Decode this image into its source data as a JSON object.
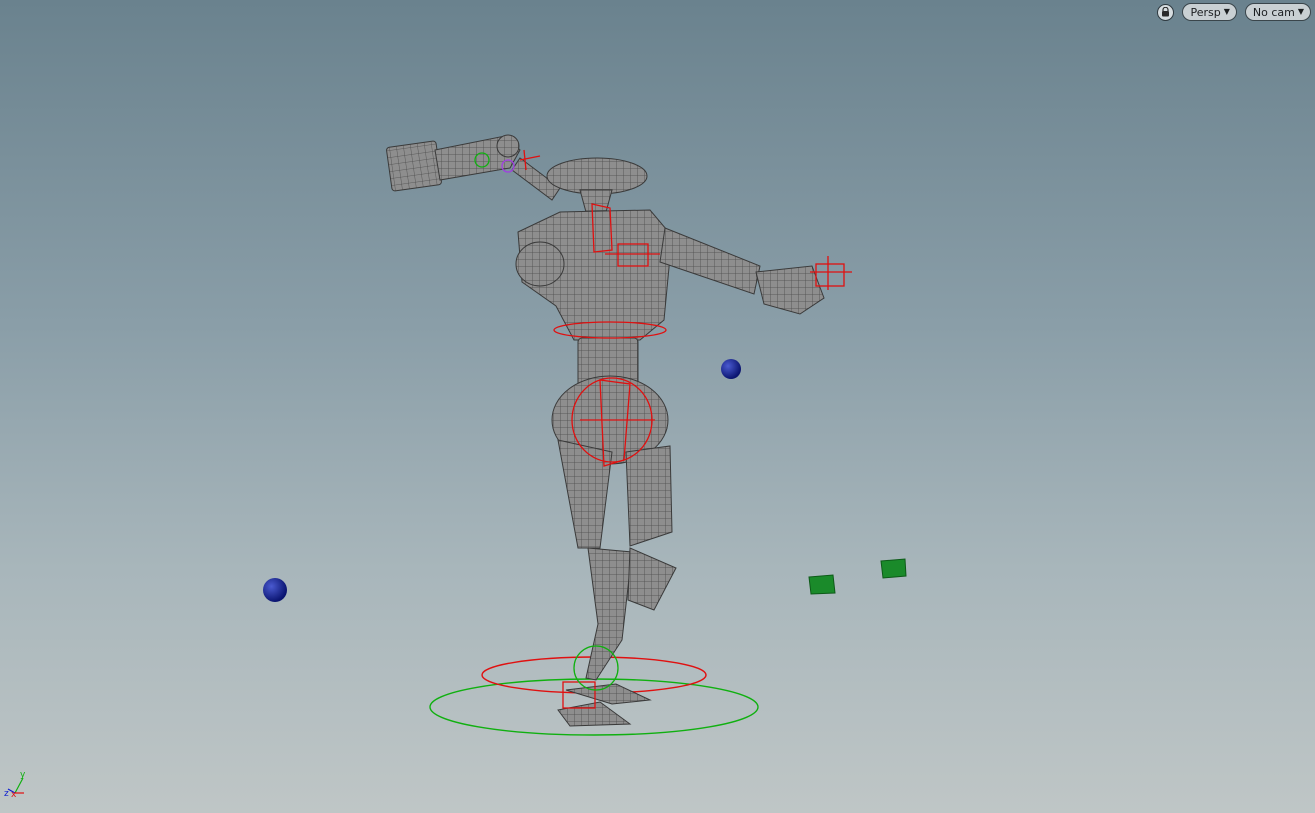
{
  "viewport": {
    "lock_icon": "lock-icon",
    "camera_mode": "Persp",
    "camera_select": "No cam",
    "dropdown_icon": "caret-down-icon"
  },
  "axis_gizmo": {
    "x": "x",
    "y": "y",
    "z": "z"
  },
  "colors": {
    "background_top": "#6a828e",
    "background_bottom": "#bfc6c6",
    "mesh": "#8a8a8a",
    "rig_control": "#e01010",
    "ground_control": "#10b010",
    "null_sphere": "#101c8c",
    "box_control": "#1a8a2a",
    "selection": "#a040e0"
  }
}
